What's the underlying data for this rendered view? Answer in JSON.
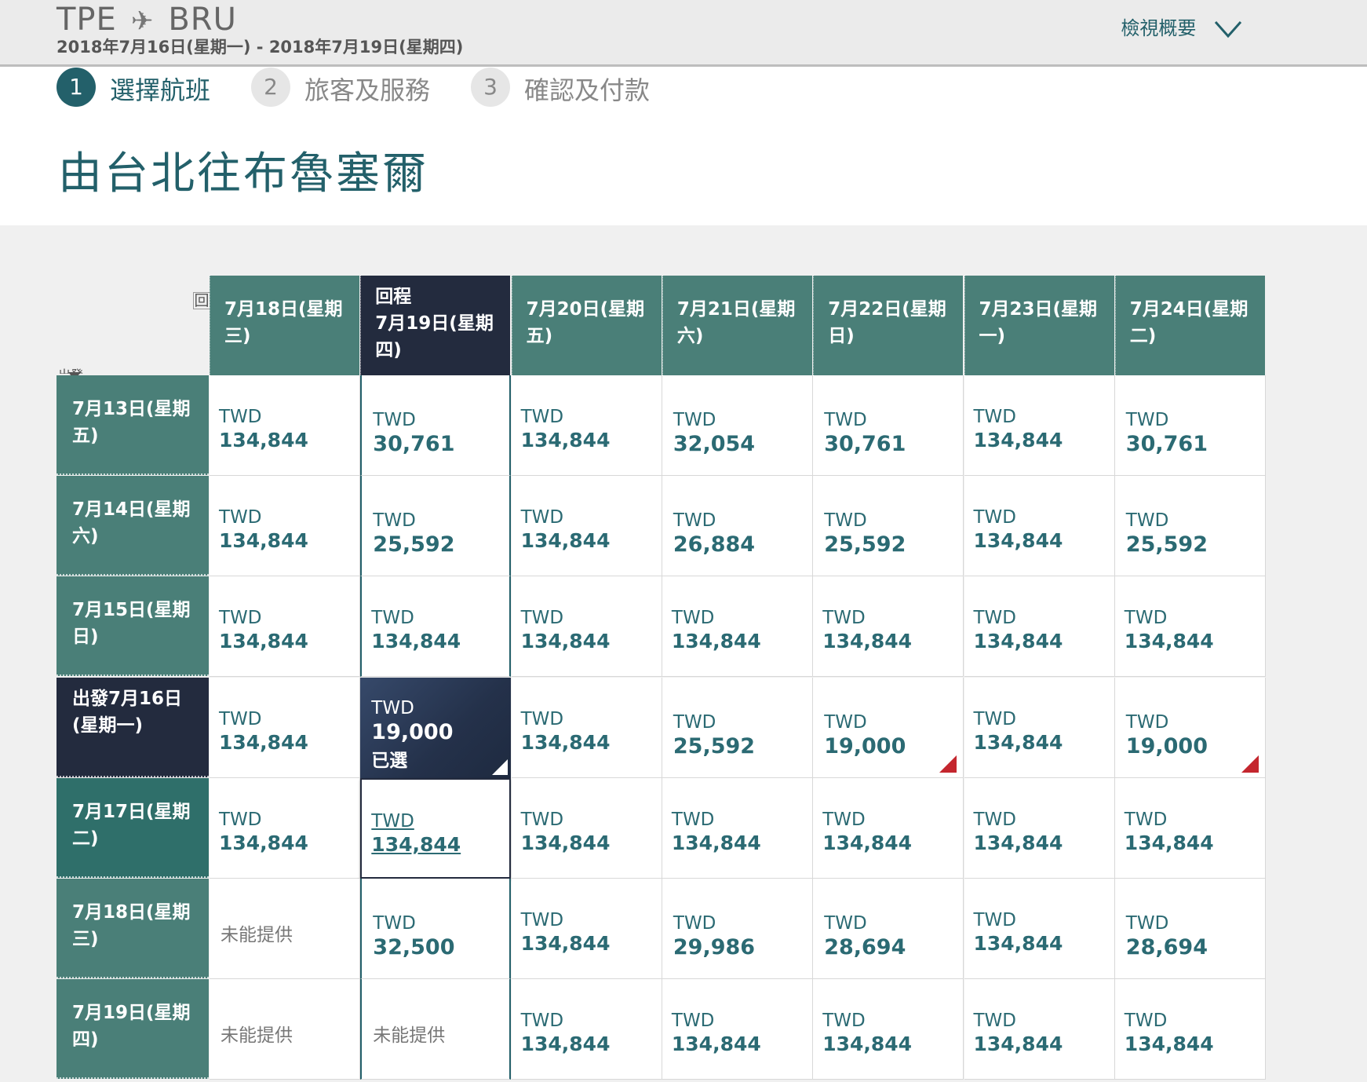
{
  "header": {
    "origin": "TPE",
    "destination": "BRU",
    "plane_icon": "airplane-icon",
    "dates": "2018年7月16日(星期一) - 2018年7月19日(星期四)",
    "summary_label": "檢視概要"
  },
  "steps": [
    {
      "num": "1",
      "label": "選擇航班"
    },
    {
      "num": "2",
      "label": "旅客及服務"
    },
    {
      "num": "3",
      "label": "確認及付款"
    }
  ],
  "page_title": "由台北往布魯塞爾",
  "grid": {
    "return_axis_label": "回",
    "depart_axis_label": "出發",
    "return_selected_tag": "回程",
    "depart_selected_tag": "出發",
    "chosen_label": "已選",
    "not_available": "未能提供",
    "columns": [
      {
        "l1": "7月18日(星期",
        "l2": "三)"
      },
      {
        "l1": "7月19日(星期",
        "l2": "四)"
      },
      {
        "l1": "7月20日(星期",
        "l2": "五)"
      },
      {
        "l1": "7月21日(星期",
        "l2": "六)"
      },
      {
        "l1": "7月22日(星期",
        "l2": "日)"
      },
      {
        "l1": "7月23日(星期",
        "l2": "一)"
      },
      {
        "l1": "7月24日(星期",
        "l2": "二)"
      }
    ],
    "rows": [
      {
        "l1": "7月13日(星期",
        "l2": "五)"
      },
      {
        "l1": "7月14日(星期",
        "l2": "六)"
      },
      {
        "l1": "7月15日(星期",
        "l2": "日)"
      },
      {
        "l1": "7月16日(星期",
        "l2": "一)"
      },
      {
        "l1": "7月17日(星期",
        "l2": "二)"
      },
      {
        "l1": "7月18日(星期",
        "l2": "三)"
      },
      {
        "l1": "7月19日(星期",
        "l2": "四)"
      }
    ],
    "currency": "TWD",
    "prices": [
      [
        "134,844",
        "30,761",
        "134,844",
        "32,054",
        "30,761",
        "134,844",
        "30,761"
      ],
      [
        "134,844",
        "25,592",
        "134,844",
        "26,884",
        "25,592",
        "134,844",
        "25,592"
      ],
      [
        "134,844",
        "134,844",
        "134,844",
        "134,844",
        "134,844",
        "134,844",
        "134,844"
      ],
      [
        "134,844",
        "19,000",
        "134,844",
        "25,592",
        "19,000",
        "134,844",
        "19,000"
      ],
      [
        "134,844",
        "134,844",
        "134,844",
        "134,844",
        "134,844",
        "134,844",
        "134,844"
      ],
      [
        null,
        "32,500",
        "134,844",
        "29,986",
        "28,694",
        "134,844",
        "28,694"
      ],
      [
        null,
        null,
        "134,844",
        "134,844",
        "134,844",
        "134,844",
        "134,844"
      ]
    ],
    "low_fares": [
      [
        false,
        true,
        false,
        true,
        true,
        false,
        true
      ],
      [
        false,
        true,
        false,
        true,
        true,
        false,
        true
      ],
      [
        false,
        false,
        false,
        false,
        false,
        false,
        false
      ],
      [
        false,
        true,
        false,
        true,
        true,
        false,
        true
      ],
      [
        false,
        false,
        false,
        false,
        false,
        false,
        false
      ],
      [
        false,
        true,
        false,
        true,
        true,
        false,
        true
      ],
      [
        false,
        false,
        false,
        false,
        false,
        false,
        false
      ]
    ],
    "selected_row": 3,
    "selected_col": 1,
    "hover_row": 4,
    "hover_col": 1,
    "red_flags": [
      [
        3,
        4
      ],
      [
        3,
        6
      ]
    ],
    "flag_color": "#c4262e"
  }
}
